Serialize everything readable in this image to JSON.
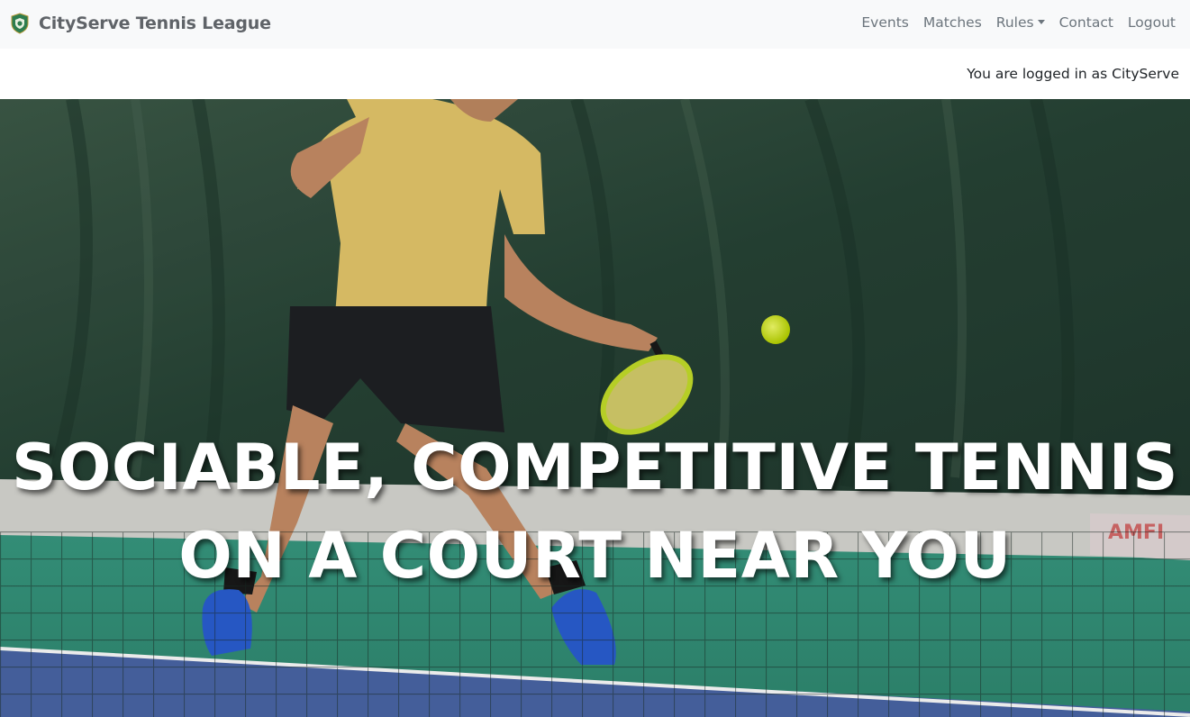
{
  "brand": {
    "name": "CityServe Tennis League",
    "logo_icon": "shield-logo-icon"
  },
  "nav": {
    "items": [
      {
        "label": "Events"
      },
      {
        "label": "Matches"
      },
      {
        "label": "Rules"
      },
      {
        "label": "Contact"
      },
      {
        "label": "Logout"
      }
    ]
  },
  "session": {
    "status": "You are logged in as CityServe"
  },
  "hero": {
    "headline_line1": "SOCIABLE, COMPETITIVE TENNIS",
    "headline_line2": "ON A COURT NEAR YOU",
    "image_description_icon": "tennis-player-photo"
  },
  "colors": {
    "navbar_bg": "#f8f9fa",
    "nav_text": "#6c757d",
    "headline": "#ffffff",
    "logo_green": "#2e7d4f"
  }
}
